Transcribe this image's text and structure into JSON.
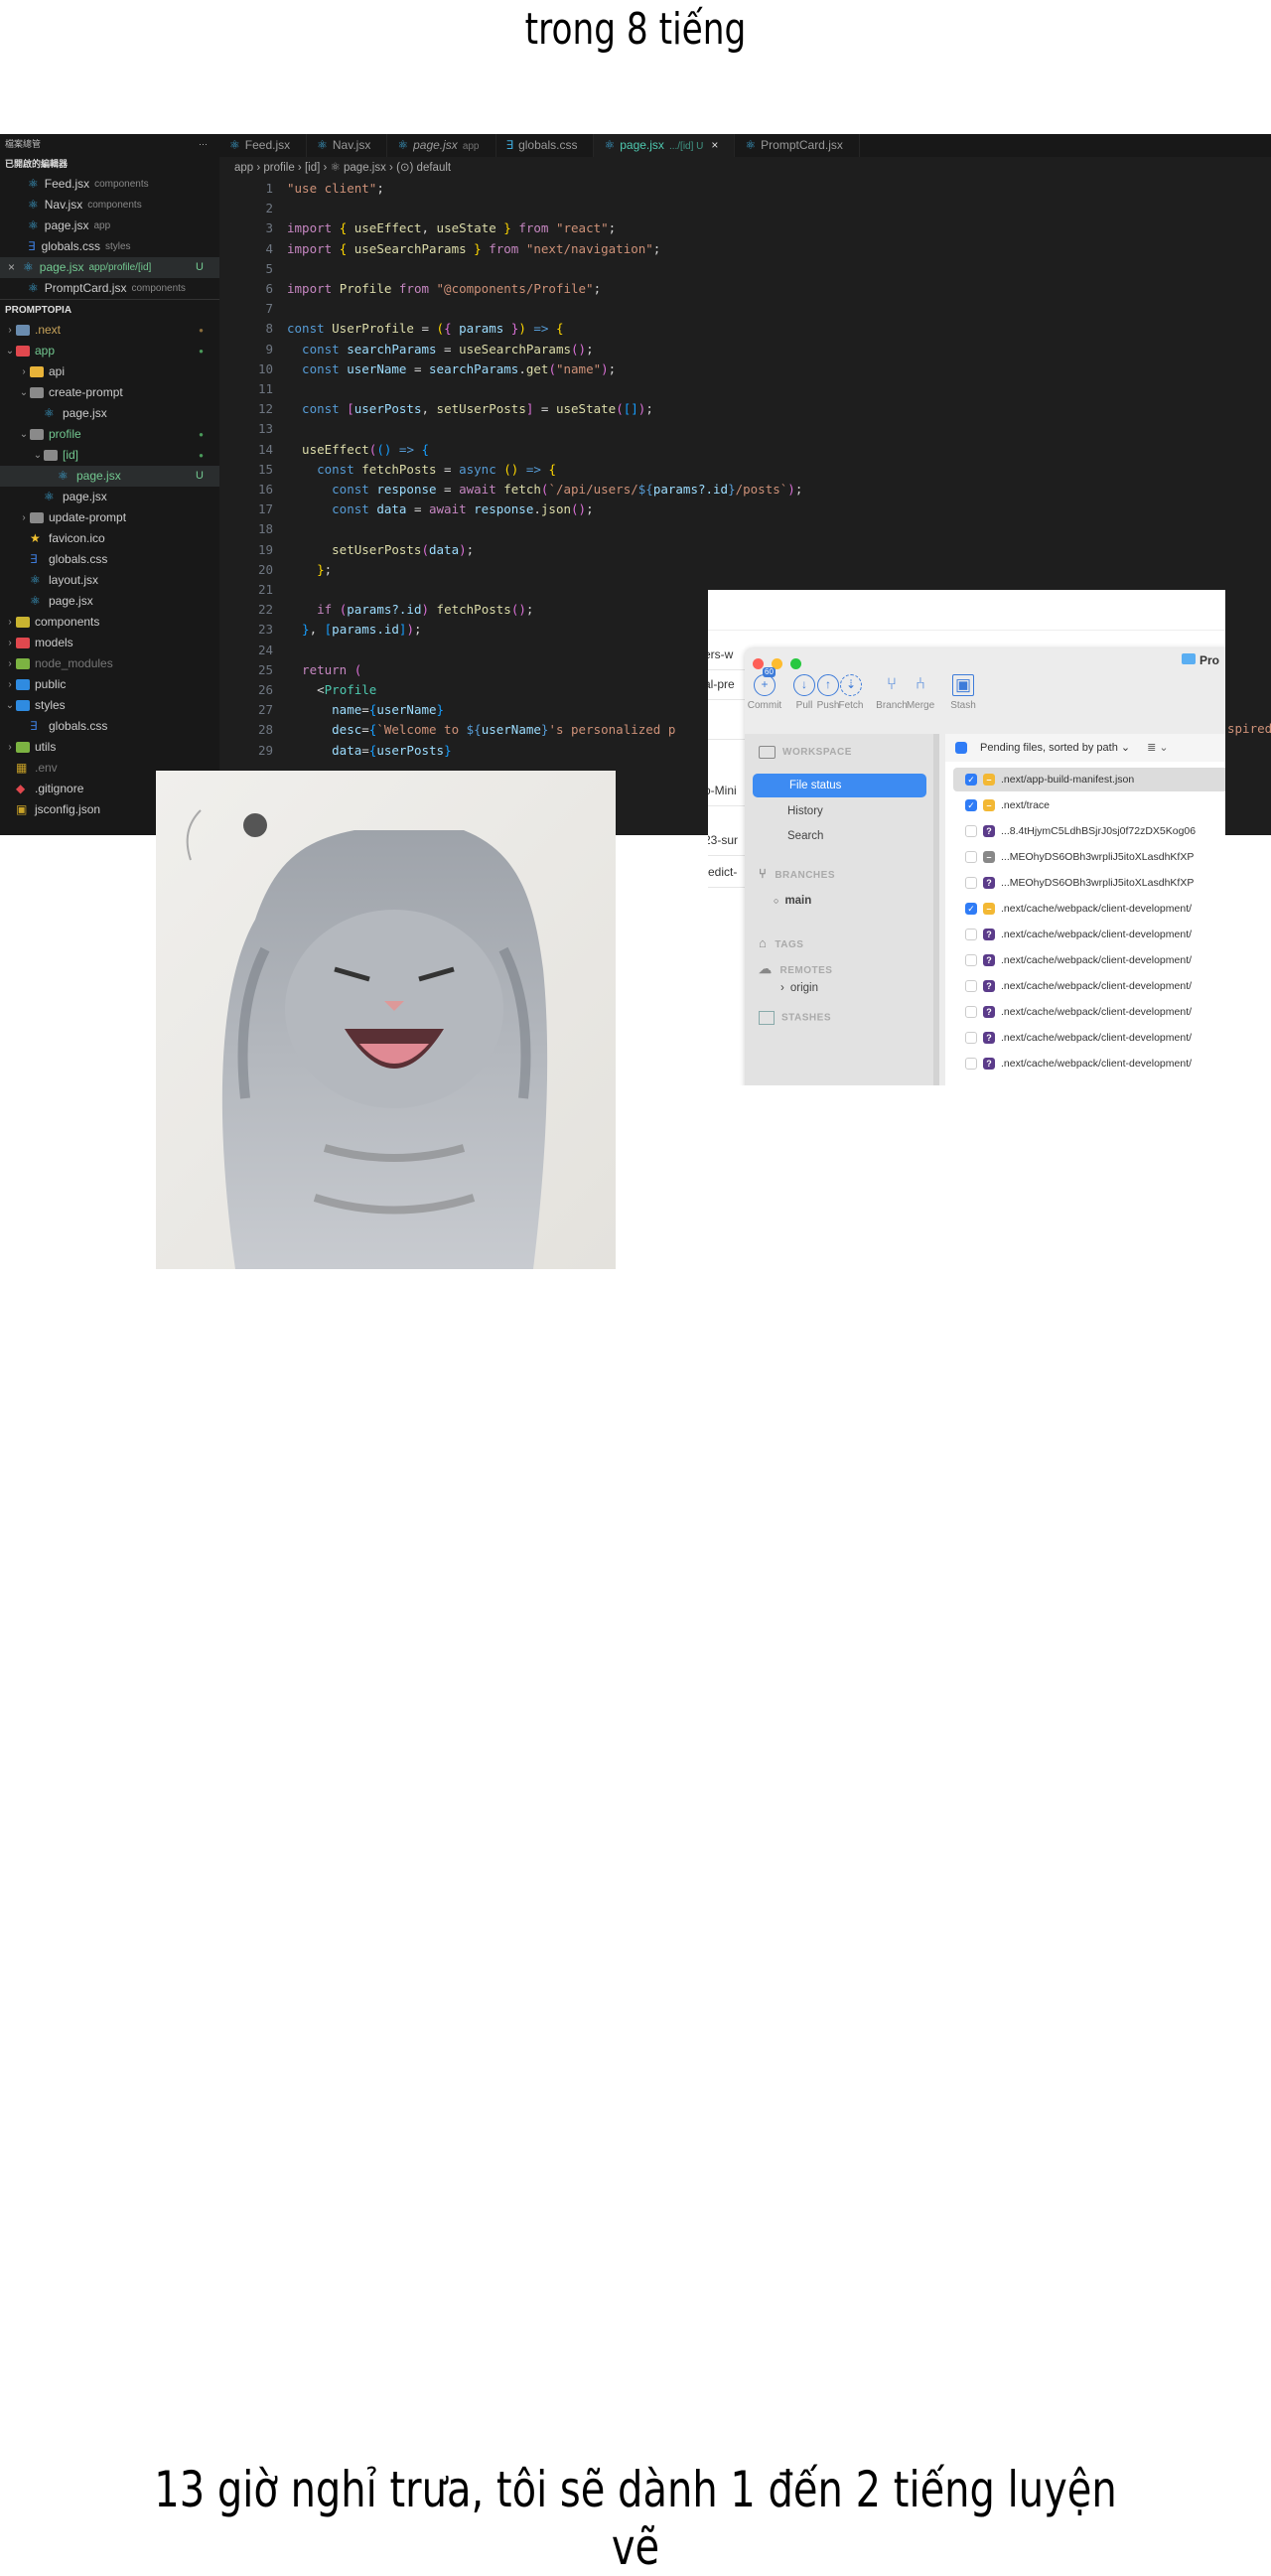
{
  "captions": {
    "top": "trong 8 tiếng",
    "bottom": "13 giờ nghỉ trưa, tôi sẽ dành 1 đến 2 tiếng luyện vẽ"
  },
  "editor": {
    "sidebar": {
      "title": "檔案總管",
      "more": "···",
      "open_editors_title": "已開啟的編輯器",
      "project_title": "PROMPTOPIA",
      "open_editors": [
        {
          "name": "Feed.jsx",
          "desc": "components",
          "icon": "react-icon"
        },
        {
          "name": "Nav.jsx",
          "desc": "components",
          "icon": "react-icon"
        },
        {
          "name": "page.jsx",
          "desc": "app",
          "icon": "react-icon"
        },
        {
          "name": "globals.css",
          "desc": "styles",
          "icon": "css-icon"
        },
        {
          "name": "page.jsx",
          "desc": "app/profile/[id]",
          "icon": "react-icon",
          "badge": "U",
          "active": true
        },
        {
          "name": "PromptCard.jsx",
          "desc": "components",
          "icon": "react-icon"
        }
      ],
      "tree": [
        {
          "name": ".next",
          "depth": 0,
          "chev": ">",
          "icon": "folder-icon",
          "color": "#6a8caf",
          "badge": "●",
          "badge_color": "#8a6d3b",
          "text_color": "#c7a35a"
        },
        {
          "name": "app",
          "depth": 0,
          "chev": "v",
          "icon": "folder-icon",
          "color": "#e0484e",
          "badge": "●",
          "badge_color": "#4a9a5a",
          "text_color": "#73c991"
        },
        {
          "name": "api",
          "depth": 1,
          "chev": ">",
          "icon": "folder-icon",
          "color": "#e8b339"
        },
        {
          "name": "create-prompt",
          "depth": 1,
          "chev": "v",
          "icon": "folder-icon",
          "color": "#8a8a8a"
        },
        {
          "name": "page.jsx",
          "depth": 2,
          "icon": "react-icon",
          "color": "#3ea8d8"
        },
        {
          "name": "profile",
          "depth": 1,
          "chev": "v",
          "icon": "folder-icon",
          "color": "#8a8a8a",
          "badge": "●",
          "badge_color": "#4a9a5a",
          "text_color": "#73c991"
        },
        {
          "name": "[id]",
          "depth": 2,
          "chev": "v",
          "icon": "folder-icon",
          "color": "#8a8a8a",
          "badge": "●",
          "badge_color": "#4a9a5a",
          "text_color": "#73c991"
        },
        {
          "name": "page.jsx",
          "depth": 3,
          "icon": "react-icon",
          "color": "#3ea8d8",
          "badge": "U",
          "badge_color": "#73c991",
          "text_color": "#73c991",
          "selected": true
        },
        {
          "name": "page.jsx",
          "depth": 2,
          "icon": "react-icon",
          "color": "#3ea8d8"
        },
        {
          "name": "update-prompt",
          "depth": 1,
          "chev": ">",
          "icon": "folder-icon",
          "color": "#8a8a8a"
        },
        {
          "name": "favicon.ico",
          "depth": 1,
          "icon": "star-icon",
          "color": "#f2c230"
        },
        {
          "name": "globals.css",
          "depth": 1,
          "icon": "css-icon",
          "color": "#3d7bd9"
        },
        {
          "name": "layout.jsx",
          "depth": 1,
          "icon": "react-icon",
          "color": "#3ea8d8"
        },
        {
          "name": "page.jsx",
          "depth": 1,
          "icon": "react-icon",
          "color": "#3ea8d8"
        },
        {
          "name": "components",
          "depth": 0,
          "chev": ">",
          "icon": "folder-icon",
          "color": "#c9b330"
        },
        {
          "name": "models",
          "depth": 0,
          "chev": ">",
          "icon": "folder-icon",
          "color": "#e0484e"
        },
        {
          "name": "node_modules",
          "depth": 0,
          "chev": ">",
          "icon": "folder-icon",
          "color": "#7cb342",
          "text_color": "#777"
        },
        {
          "name": "public",
          "depth": 0,
          "chev": ">",
          "icon": "folder-icon",
          "color": "#2f8be0"
        },
        {
          "name": "styles",
          "depth": 0,
          "chev": "v",
          "icon": "folder-icon",
          "color": "#2f8be0"
        },
        {
          "name": "globals.css",
          "depth": 1,
          "icon": "css-icon",
          "color": "#3d7bd9"
        },
        {
          "name": "utils",
          "depth": 0,
          "chev": ">",
          "icon": "folder-icon",
          "color": "#7cb342"
        },
        {
          "name": ".env",
          "depth": 0,
          "icon": "env-icon",
          "color": "#c9a227",
          "text_color": "#777"
        },
        {
          "name": ".gitignore",
          "depth": 0,
          "icon": "git-icon",
          "color": "#e0484e"
        },
        {
          "name": "jsconfig.json",
          "depth": 0,
          "icon": "json-icon",
          "color": "#c9a227"
        }
      ]
    },
    "tabs": [
      {
        "label": "Feed.jsx"
      },
      {
        "label": "Nav.jsx"
      },
      {
        "label": "page.jsx",
        "desc": "app"
      },
      {
        "label": "globals.css"
      },
      {
        "label": "page.jsx",
        "desc": ".../[id] U",
        "active": true,
        "close": "×"
      },
      {
        "label": "PromptCard.jsx"
      }
    ],
    "breadcrumb": "app › profile › [id] › ⚛ page.jsx › (⊙) default",
    "code": [
      [
        [
          "s",
          "\"use client\""
        ],
        [
          "d",
          ";"
        ]
      ],
      [],
      [
        [
          "k",
          "import "
        ],
        [
          "p",
          "{ "
        ],
        [
          "f",
          "useEffect"
        ],
        [
          "d",
          ", "
        ],
        [
          "f",
          "useState"
        ],
        [
          "p",
          " }"
        ],
        [
          "k",
          " from "
        ],
        [
          "s",
          "\"react\""
        ],
        [
          "d",
          ";"
        ]
      ],
      [
        [
          "k",
          "import "
        ],
        [
          "p",
          "{ "
        ],
        [
          "f",
          "useSearchParams"
        ],
        [
          "p",
          " }"
        ],
        [
          "k",
          " from "
        ],
        [
          "s",
          "\"next/navigation\""
        ],
        [
          "d",
          ";"
        ]
      ],
      [],
      [
        [
          "k",
          "import "
        ],
        [
          "f",
          "Profile"
        ],
        [
          "k",
          " from "
        ],
        [
          "s",
          "\"@components/Profile\""
        ],
        [
          "d",
          ";"
        ]
      ],
      [],
      [
        [
          "c",
          "const "
        ],
        [
          "f",
          "UserProfile"
        ],
        [
          "d",
          " = "
        ],
        [
          "p",
          "("
        ],
        [
          "b",
          "{ "
        ],
        [
          "v",
          "params"
        ],
        [
          "b",
          " }"
        ],
        [
          "p",
          ")"
        ],
        [
          "c",
          " => "
        ],
        [
          "p",
          "{"
        ]
      ],
      [
        [
          "c",
          "  const "
        ],
        [
          "v",
          "searchParams"
        ],
        [
          "d",
          " = "
        ],
        [
          "f",
          "useSearchParams"
        ],
        [
          "b",
          "()"
        ],
        [
          "d",
          ";"
        ]
      ],
      [
        [
          "c",
          "  const "
        ],
        [
          "v",
          "userName"
        ],
        [
          "d",
          " = "
        ],
        [
          "v",
          "searchParams"
        ],
        [
          "d",
          "."
        ],
        [
          "f",
          "get"
        ],
        [
          "b",
          "("
        ],
        [
          "s",
          "\"name\""
        ],
        [
          "b",
          ")"
        ],
        [
          "d",
          ";"
        ]
      ],
      [],
      [
        [
          "c",
          "  const "
        ],
        [
          "b",
          "["
        ],
        [
          "v",
          "userPosts"
        ],
        [
          "d",
          ", "
        ],
        [
          "f",
          "setUserPosts"
        ],
        [
          "b",
          "]"
        ],
        [
          "d",
          " = "
        ],
        [
          "f",
          "useState"
        ],
        [
          "b",
          "("
        ],
        [
          "g",
          "[]"
        ],
        [
          "b",
          ")"
        ],
        [
          "d",
          ";"
        ]
      ],
      [],
      [
        [
          "f",
          "  useEffect"
        ],
        [
          "b",
          "("
        ],
        [
          "g",
          "()"
        ],
        [
          "c",
          " => "
        ],
        [
          "g",
          "{"
        ]
      ],
      [
        [
          "c",
          "    const "
        ],
        [
          "f",
          "fetchPosts"
        ],
        [
          "d",
          " = "
        ],
        [
          "c",
          "async "
        ],
        [
          "p",
          "()"
        ],
        [
          "c",
          " => "
        ],
        [
          "p",
          "{"
        ]
      ],
      [
        [
          "c",
          "      const "
        ],
        [
          "v",
          "response"
        ],
        [
          "d",
          " = "
        ],
        [
          "k",
          "await "
        ],
        [
          "f",
          "fetch"
        ],
        [
          "b",
          "("
        ],
        [
          "s",
          "`/api/users/"
        ],
        [
          "c",
          "${"
        ],
        [
          "v",
          "params?.id"
        ],
        [
          "c",
          "}"
        ],
        [
          "s",
          "/posts`"
        ],
        [
          "b",
          ")"
        ],
        [
          "d",
          ";"
        ]
      ],
      [
        [
          "c",
          "      const "
        ],
        [
          "v",
          "data"
        ],
        [
          "d",
          " = "
        ],
        [
          "k",
          "await "
        ],
        [
          "v",
          "response"
        ],
        [
          "d",
          "."
        ],
        [
          "f",
          "json"
        ],
        [
          "b",
          "()"
        ],
        [
          "d",
          ";"
        ]
      ],
      [],
      [
        [
          "f",
          "      setUserPosts"
        ],
        [
          "b",
          "("
        ],
        [
          "v",
          "data"
        ],
        [
          "b",
          ")"
        ],
        [
          "d",
          ";"
        ]
      ],
      [
        [
          "p",
          "    }"
        ],
        [
          "d",
          ";"
        ]
      ],
      [],
      [
        [
          "k",
          "    if "
        ],
        [
          "b",
          "("
        ],
        [
          "v",
          "params?.id"
        ],
        [
          "b",
          ") "
        ],
        [
          "f",
          "fetchPosts"
        ],
        [
          "b",
          "()"
        ],
        [
          "d",
          ";"
        ]
      ],
      [
        [
          "g",
          "  }"
        ],
        [
          "d",
          ", "
        ],
        [
          "g",
          "["
        ],
        [
          "v",
          "params.id"
        ],
        [
          "g",
          "]"
        ],
        [
          "b",
          ")"
        ],
        [
          "d",
          ";"
        ]
      ],
      [],
      [
        [
          "k",
          "  return "
        ],
        [
          "b",
          "("
        ]
      ],
      [
        [
          "d",
          "    <"
        ],
        [
          "t",
          "Profile"
        ]
      ],
      [
        [
          "v",
          "      name"
        ],
        [
          "d",
          "="
        ],
        [
          "g",
          "{"
        ],
        [
          "v",
          "userName"
        ],
        [
          "g",
          "}"
        ]
      ],
      [
        [
          "v",
          "      desc"
        ],
        [
          "d",
          "="
        ],
        [
          "g",
          "{"
        ],
        [
          "s",
          "`Welcome to "
        ],
        [
          "c",
          "${"
        ],
        [
          "v",
          "userName"
        ],
        [
          "c",
          "}"
        ],
        [
          "s",
          "'s personalized p"
        ]
      ],
      [
        [
          "v",
          "      data"
        ],
        [
          "d",
          "="
        ],
        [
          "g",
          "{"
        ],
        [
          "v",
          "userPosts"
        ],
        [
          "g",
          "}"
        ]
      ]
    ],
    "code_fragment_right": "spired"
  },
  "sourcetree": {
    "background_fragments": [
      "ers-w",
      "al-pre",
      "t",
      "o-Mini",
      "23-sur",
      "redict-"
    ],
    "repo_title": "Pro",
    "toolbar": [
      {
        "label": "Commit",
        "icon": "commit-icon",
        "badge": "60"
      },
      {
        "label": "Pull",
        "icon": "pull-icon"
      },
      {
        "label": "Push",
        "icon": "push-icon"
      },
      {
        "label": "Fetch",
        "icon": "fetch-icon"
      },
      {
        "label": "Branch",
        "icon": "branch-icon"
      },
      {
        "label": "Merge",
        "icon": "merge-icon"
      },
      {
        "label": "Stash",
        "icon": "stash-icon"
      }
    ],
    "sidebar": {
      "workspace": "WORKSPACE",
      "file_status": "File status",
      "history": "History",
      "search": "Search",
      "branches": "BRANCHES",
      "branch_main": "main",
      "tags": "TAGS",
      "remotes": "REMOTES",
      "remote_origin": "origin",
      "stashes": "STASHES"
    },
    "pending_label": "Pending files, sorted by path ⌄",
    "view_toggle": "≣ ⌄",
    "files": [
      {
        "name": ".next/app-build-manifest.json",
        "checked": true,
        "status": "modified",
        "selected": true
      },
      {
        "name": ".next/trace",
        "checked": true,
        "status": "modified"
      },
      {
        "name": "...8.4tHjymC5LdhBSjrJ0sj0f72zDX5Kog06",
        "checked": false,
        "status": "untracked"
      },
      {
        "name": "...MEOhyDS6OBh3wrpliJ5itoXLasdhKfXP",
        "checked": false,
        "status": "ignored"
      },
      {
        "name": "...MEOhyDS6OBh3wrpliJ5itoXLasdhKfXP",
        "checked": false,
        "status": "untracked"
      },
      {
        "name": ".next/cache/webpack/client-development/",
        "checked": true,
        "status": "modified"
      },
      {
        "name": ".next/cache/webpack/client-development/",
        "checked": false,
        "status": "untracked"
      },
      {
        "name": ".next/cache/webpack/client-development/",
        "checked": false,
        "status": "untracked"
      },
      {
        "name": ".next/cache/webpack/client-development/",
        "checked": false,
        "status": "untracked"
      },
      {
        "name": ".next/cache/webpack/client-development/",
        "checked": false,
        "status": "untracked"
      },
      {
        "name": ".next/cache/webpack/client-development/",
        "checked": false,
        "status": "untracked"
      },
      {
        "name": ".next/cache/webpack/client-development/",
        "checked": false,
        "status": "untracked"
      }
    ]
  }
}
